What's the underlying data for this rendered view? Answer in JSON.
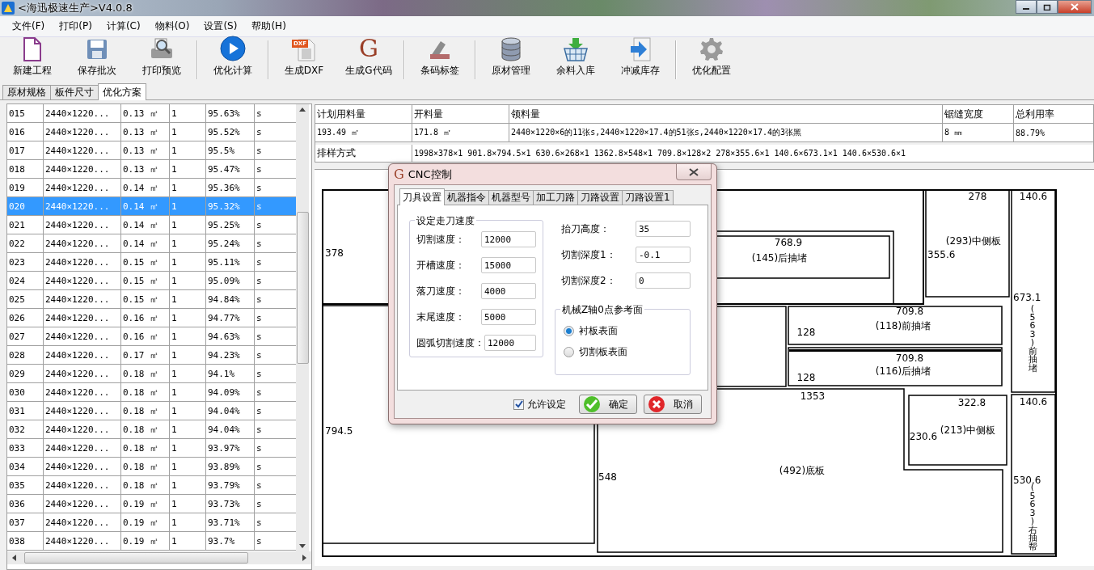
{
  "window": {
    "title": "<海迅极速生产>V4.0.8"
  },
  "menu": [
    "文件(F)",
    "打印(P)",
    "计算(C)",
    "物料(O)",
    "设置(S)",
    "帮助(H)"
  ],
  "toolbar": [
    {
      "label": "新建工程"
    },
    {
      "label": "保存批次"
    },
    {
      "label": "打印预览"
    },
    {
      "label": "优化计算"
    },
    {
      "label": "生成DXF",
      "icon_text": "DXF"
    },
    {
      "label": "生成G代码",
      "icon_text": "G"
    },
    {
      "label": "条码标签"
    },
    {
      "label": "原材管理"
    },
    {
      "label": "余料入库"
    },
    {
      "label": "冲减库存"
    },
    {
      "label": "优化配置"
    }
  ],
  "tabs": [
    {
      "label": "原材规格",
      "selected": false
    },
    {
      "label": "板件尺寸",
      "selected": false
    },
    {
      "label": "优化方案",
      "selected": true
    }
  ],
  "table": {
    "rows": [
      {
        "cells": [
          "015",
          "2440×1220...",
          "0.13 ㎡",
          "1",
          "95.63%",
          "s"
        ],
        "selected": false
      },
      {
        "cells": [
          "016",
          "2440×1220...",
          "0.13 ㎡",
          "1",
          "95.52%",
          "s"
        ],
        "selected": false
      },
      {
        "cells": [
          "017",
          "2440×1220...",
          "0.13 ㎡",
          "1",
          "95.5%",
          "s"
        ],
        "selected": false
      },
      {
        "cells": [
          "018",
          "2440×1220...",
          "0.13 ㎡",
          "1",
          "95.47%",
          "s"
        ],
        "selected": false
      },
      {
        "cells": [
          "019",
          "2440×1220...",
          "0.14 ㎡",
          "1",
          "95.36%",
          "s"
        ],
        "selected": false
      },
      {
        "cells": [
          "020",
          "2440×1220...",
          "0.14 ㎡",
          "1",
          "95.32%",
          "s"
        ],
        "selected": true
      },
      {
        "cells": [
          "021",
          "2440×1220...",
          "0.14 ㎡",
          "1",
          "95.25%",
          "s"
        ],
        "selected": false
      },
      {
        "cells": [
          "022",
          "2440×1220...",
          "0.14 ㎡",
          "1",
          "95.24%",
          "s"
        ],
        "selected": false
      },
      {
        "cells": [
          "023",
          "2440×1220...",
          "0.15 ㎡",
          "1",
          "95.11%",
          "s"
        ],
        "selected": false
      },
      {
        "cells": [
          "024",
          "2440×1220...",
          "0.15 ㎡",
          "1",
          "95.09%",
          "s"
        ],
        "selected": false
      },
      {
        "cells": [
          "025",
          "2440×1220...",
          "0.15 ㎡",
          "1",
          "94.84%",
          "s"
        ],
        "selected": false
      },
      {
        "cells": [
          "026",
          "2440×1220...",
          "0.16 ㎡",
          "1",
          "94.77%",
          "s"
        ],
        "selected": false
      },
      {
        "cells": [
          "027",
          "2440×1220...",
          "0.16 ㎡",
          "1",
          "94.63%",
          "s"
        ],
        "selected": false
      },
      {
        "cells": [
          "028",
          "2440×1220...",
          "0.17 ㎡",
          "1",
          "94.23%",
          "s"
        ],
        "selected": false
      },
      {
        "cells": [
          "029",
          "2440×1220...",
          "0.18 ㎡",
          "1",
          "94.1%",
          "s"
        ],
        "selected": false
      },
      {
        "cells": [
          "030",
          "2440×1220...",
          "0.18 ㎡",
          "1",
          "94.09%",
          "s"
        ],
        "selected": false
      },
      {
        "cells": [
          "031",
          "2440×1220...",
          "0.18 ㎡",
          "1",
          "94.04%",
          "s"
        ],
        "selected": false
      },
      {
        "cells": [
          "032",
          "2440×1220...",
          "0.18 ㎡",
          "1",
          "94.04%",
          "s"
        ],
        "selected": false
      },
      {
        "cells": [
          "033",
          "2440×1220...",
          "0.18 ㎡",
          "1",
          "93.97%",
          "s"
        ],
        "selected": false
      },
      {
        "cells": [
          "034",
          "2440×1220...",
          "0.18 ㎡",
          "1",
          "93.89%",
          "s"
        ],
        "selected": false
      },
      {
        "cells": [
          "035",
          "2440×1220...",
          "0.18 ㎡",
          "1",
          "93.79%",
          "s"
        ],
        "selected": false
      },
      {
        "cells": [
          "036",
          "2440×1220...",
          "0.19 ㎡",
          "1",
          "93.73%",
          "s"
        ],
        "selected": false
      },
      {
        "cells": [
          "037",
          "2440×1220...",
          "0.19 ㎡",
          "1",
          "93.71%",
          "s"
        ],
        "selected": false
      },
      {
        "cells": [
          "038",
          "2440×1220...",
          "0.19 ㎡",
          "1",
          "93.7%",
          "s"
        ],
        "selected": false
      }
    ]
  },
  "summary": {
    "columns": [
      "计划用料量",
      "开料量",
      "领料量",
      "锯缝宽度",
      "总利用率"
    ],
    "values": [
      "193.49 ㎡",
      "171.8 ㎡",
      "2440×1220×6的11张s,2440×1220×17.4的51张s,2440×1220×17.4的3张黑",
      "8 ㎜",
      "88.79%"
    ]
  },
  "layout_method": {
    "label": "排样方式",
    "value": "1998×378×1 901.8×794.5×1 630.6×268×1 1362.8×548×1 709.8×128×2 278×355.6×1 140.6×673.1×1 140.6×530.6×1"
  },
  "nesting": {
    "labels": [
      {
        "text": "378",
        "kind": "dimension"
      },
      {
        "text": "794.5",
        "kind": "dimension"
      },
      {
        "text": "548",
        "kind": "dimension"
      },
      {
        "text": "768.9",
        "kind": "dimension"
      },
      {
        "text": "(145)后抽堵",
        "kind": "part"
      },
      {
        "text": "278",
        "kind": "dimension"
      },
      {
        "text": "140.6",
        "kind": "dimension"
      },
      {
        "text": "355.6",
        "kind": "dimension"
      },
      {
        "text": "(293)中侧板",
        "kind": "part"
      },
      {
        "text": "673.1",
        "kind": "dimension"
      },
      {
        "text": "709.8",
        "kind": "dimension"
      },
      {
        "text": "(118)前抽堵",
        "kind": "part"
      },
      {
        "text": "128",
        "kind": "dimension"
      },
      {
        "text": "709.8",
        "kind": "dimension"
      },
      {
        "text": "(116)后抽堵",
        "kind": "part"
      },
      {
        "text": "128",
        "kind": "dimension"
      },
      {
        "text": "(563)前抽堵",
        "kind": "part_vertical"
      },
      {
        "text": "1353",
        "kind": "dimension"
      },
      {
        "text": "322.8",
        "kind": "dimension"
      },
      {
        "text": "230.6",
        "kind": "dimension"
      },
      {
        "text": "(213)中侧板",
        "kind": "part"
      },
      {
        "text": "(492)底板",
        "kind": "part"
      },
      {
        "text": "140.6",
        "kind": "dimension"
      },
      {
        "text": "530.6",
        "kind": "dimension"
      },
      {
        "text": "(563)右抽帮",
        "kind": "part_vertical"
      }
    ]
  },
  "dialog": {
    "title": "CNC控制",
    "icon_text": "G",
    "tabs": [
      {
        "label": "刀具设置",
        "selected": true
      },
      {
        "label": "机器指令",
        "selected": false
      },
      {
        "label": "机器型号",
        "selected": false
      },
      {
        "label": "加工刀路",
        "selected": false
      },
      {
        "label": "刀路设置",
        "selected": false
      },
      {
        "label": "刀路设置1",
        "selected": false
      }
    ],
    "speed_group": {
      "title": "设定走刀速度",
      "fields": [
        {
          "label": "切割速度：",
          "value": "12000"
        },
        {
          "label": "开槽速度：",
          "value": "15000"
        },
        {
          "label": "落刀速度：",
          "value": "4000"
        },
        {
          "label": "末尾速度：",
          "value": "5000"
        },
        {
          "label": "圆弧切割速度：",
          "value": "12000"
        }
      ]
    },
    "right_fields": [
      {
        "label": "抬刀高度：",
        "value": "35"
      },
      {
        "label": "切割深度1：",
        "value": "-0.1"
      },
      {
        "label": "切割深度2：",
        "value": "0"
      }
    ],
    "reference_group": {
      "title": "机械Z轴0点参考面",
      "options": [
        {
          "label": "衬板表面",
          "selected": true
        },
        {
          "label": "切割板表面",
          "selected": false
        }
      ]
    },
    "allow": {
      "label": "允许设定",
      "checked": true
    },
    "buttons": [
      {
        "label": "确定",
        "kind": "ok"
      },
      {
        "label": "取消",
        "kind": "cancel"
      }
    ]
  }
}
